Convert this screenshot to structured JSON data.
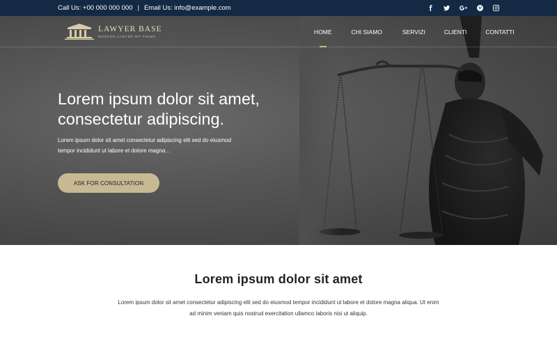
{
  "topbar": {
    "phone": "Call Us: +00 000 000 000",
    "separator": "|",
    "email": "Email Us: info@example.com",
    "social": [
      {
        "icon": "facebook-icon",
        "glyph": "f"
      },
      {
        "icon": "twitter-icon",
        "glyph": "t"
      },
      {
        "icon": "google-plus-icon",
        "glyph": "G+"
      },
      {
        "icon": "pinterest-icon",
        "glyph": "p"
      },
      {
        "icon": "instagram-icon",
        "glyph": "ig"
      }
    ]
  },
  "logo": {
    "name": "LAWYER BASE",
    "tagline": "MODERN LAWYER WP THEME"
  },
  "nav": {
    "items": [
      {
        "label": "HOME",
        "active": true
      },
      {
        "label": "CHI SIAMO",
        "active": false
      },
      {
        "label": "SERVIZI",
        "active": false
      },
      {
        "label": "CLIENTI",
        "active": false
      },
      {
        "label": "CONTATTI",
        "active": false
      }
    ]
  },
  "hero": {
    "title_line1": "Lorem ipsum dolor sit amet,",
    "title_line2": "consectetur adipiscing.",
    "lead_line1": "Lorem ipsum dolor sit amet consectetur adipiscing elit sed do eiusmod",
    "lead_line2": "tempor incididunt ut labore et dolore magna...",
    "cta": "ASK FOR CONSULTATION"
  },
  "section": {
    "title": "Lorem ipsum dolor sit amet",
    "text_line1": "Lorem ipsum dolor sit amet consectetur adipiscing elit sed do eiusmod tempor incididunt ut labore et dolore magna aliqua. Ut enim",
    "text_line2": "ad minim veniam quis nostrud exercitation ullamco laboris nisi ut aliquip."
  },
  "colors": {
    "topbar_bg": "#142a44",
    "accent_gold": "#c7b994",
    "hero_overlay": "#4f4f4f"
  }
}
